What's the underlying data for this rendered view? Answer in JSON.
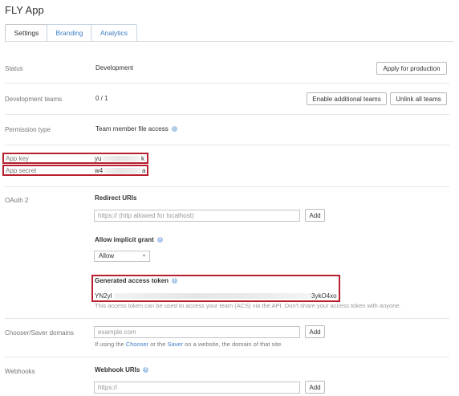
{
  "app": {
    "title": "FLY App"
  },
  "tabs": [
    {
      "label": "Settings"
    },
    {
      "label": "Branding"
    },
    {
      "label": "Analytics"
    }
  ],
  "status": {
    "label": "Status",
    "value": "Development",
    "button": "Apply for production"
  },
  "dev_teams": {
    "label": "Development teams",
    "value": "0 / 1",
    "enable_button": "Enable additional teams",
    "unlink_button": "Unlink all teams"
  },
  "permission": {
    "label": "Permission type",
    "value": "Team member file access"
  },
  "app_key": {
    "label": "App key",
    "prefix": "yu",
    "suffix": "k"
  },
  "app_secret": {
    "label": "App secret",
    "prefix": "w4",
    "suffix": "a"
  },
  "oauth": {
    "label": "OAuth 2",
    "redirect_heading": "Redirect URIs",
    "redirect_placeholder": "https:// (http allowed for localhost)",
    "add_label": "Add",
    "implicit_heading": "Allow implicit grant",
    "implicit_value": "Allow",
    "token_heading": "Generated access token",
    "token_prefix": "YN2yl",
    "token_suffix": "3ykO4xo",
    "token_note": "This access token can be used to access your team (ACS) via the API. Don't share your access token with anyone."
  },
  "chooser": {
    "label": "Chooser/Saver domains",
    "placeholder": "example.com",
    "add_label": "Add",
    "help_pre": "If using the ",
    "help_link1": "Chooser",
    "help_mid": " or the ",
    "help_link2": "Saver",
    "help_post": " on a website, the domain of that site."
  },
  "webhooks": {
    "label": "Webhooks",
    "heading": "Webhook URIs",
    "placeholder": "https://",
    "add_label": "Add"
  },
  "colors": {
    "accent": "#3f7ec4",
    "highlight": "#b81f2f"
  }
}
